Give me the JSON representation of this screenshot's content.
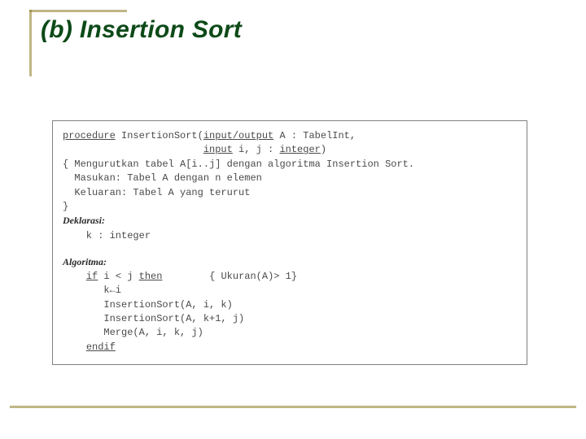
{
  "title": "(b) Insertion Sort",
  "code": {
    "proc_kw": "procedure",
    "proc_name": " InsertionSort(",
    "io_kw": "input/output",
    "proc_mid1": " A : TabelInt,",
    "indent1": "                        ",
    "input_kw": "input",
    "proc_mid2": " i, j : ",
    "integer_kw": "integer",
    "close_paren": ")",
    "c1": "{ Mengurutkan tabel A[i..j] dengan algoritma Insertion Sort.",
    "c2": "  Masukan: Tabel A dengan n elemen",
    "c3": "  Keluaran: Tabel A yang terurut",
    "c4": "}",
    "dekl": "Deklarasi:",
    "dekl1": "    k : integer",
    "algo": "Algoritma:",
    "a1_indent": "    ",
    "a1_if": "if",
    "a1_mid": " i < j ",
    "a1_then": "then",
    "a1_comment": "        { Ukuran(A)> 1}",
    "a2": "       k←i",
    "a3": "       InsertionSort(A, i, k)",
    "a4": "       InsertionSort(A, k+1, j)",
    "a5": "       Merge(A, i, k, j)",
    "a6_indent": "    ",
    "a6_endif": "endif"
  }
}
